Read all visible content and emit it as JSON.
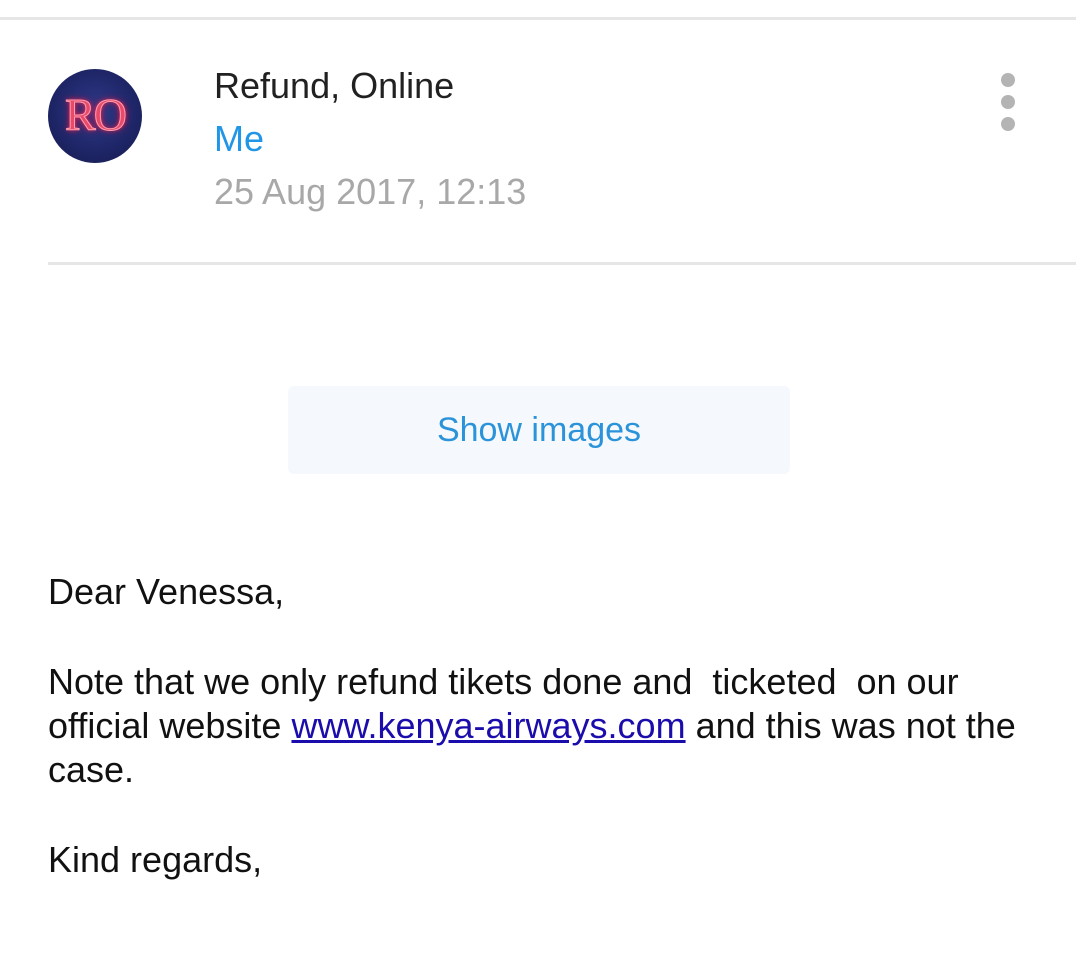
{
  "header": {
    "avatar_initials": "RO",
    "sender_name": "Refund, Online",
    "recipient": "Me",
    "timestamp": "25 Aug 2017, 12:13"
  },
  "show_images_label": "Show images",
  "message": {
    "greeting": "Dear Venessa,",
    "paragraph_before_link": "Note that we only refund tikets done and  ticketed  on our official website ",
    "link_text": "www.kenya-airways.com",
    "paragraph_after_link": " and this was not the case.",
    "closing": "Kind regards,"
  },
  "colors": {
    "recipient": "#2196e6",
    "timestamp": "#a8a8a8",
    "show_images_text": "#2b93d9",
    "link": "#1a0dab",
    "avatar_background": "#1e2566",
    "avatar_text": "#e84a6a"
  },
  "icons": {
    "overflow_menu": "more-vert-icon"
  }
}
